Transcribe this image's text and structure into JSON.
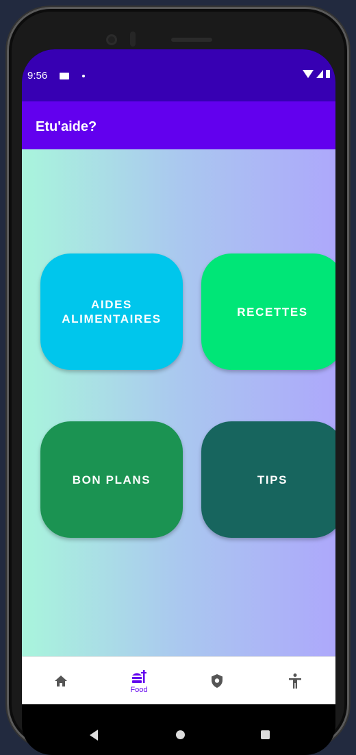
{
  "status_bar": {
    "time": "9:56"
  },
  "app_bar": {
    "title": "Etu'aide?"
  },
  "tiles": [
    {
      "label": "AIDES\nALIMENTAIRES",
      "color": "#00c6ec"
    },
    {
      "label": "RECETTES",
      "color": "#00e677"
    },
    {
      "label": "BON PLANS",
      "color": "#1b9352"
    },
    {
      "label": "TIPS",
      "color": "#17655e"
    }
  ],
  "bottom_nav": {
    "items": [
      {
        "icon": "home-icon",
        "label": ""
      },
      {
        "icon": "food-icon",
        "label": "Food",
        "selected": true
      },
      {
        "icon": "shield-icon",
        "label": ""
      },
      {
        "icon": "accessibility-icon",
        "label": ""
      }
    ],
    "active_color": "#6200ee"
  },
  "colors": {
    "status_bar": "#3700b3",
    "app_bar": "#6200ee"
  }
}
